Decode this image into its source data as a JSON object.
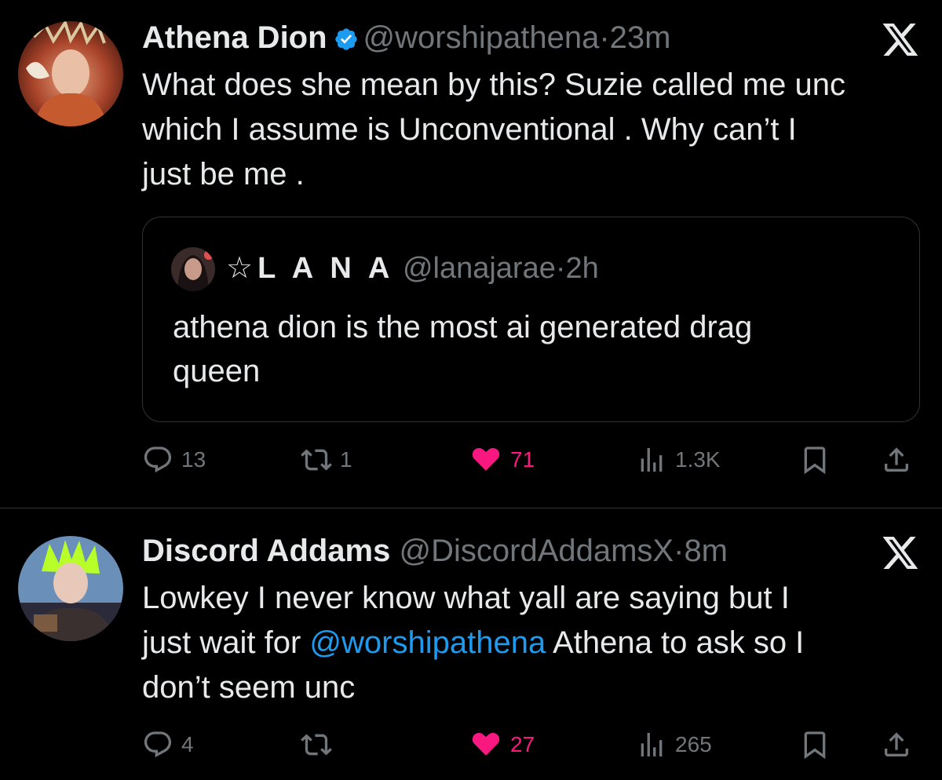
{
  "tweets": [
    {
      "name": "Athena Dion",
      "handle": "@worshipathena",
      "separator": "·",
      "time": "23m",
      "text": "What does she mean by this? Suzie called me unc\nwhich I assume is Unconventional . Why can’t I\njust be me .",
      "quote": {
        "name": "☆L A N A",
        "handle": "@lanajarae",
        "separator": "·",
        "time": "2h",
        "text": "athena dion is the most ai generated drag\nqueen"
      },
      "replies": "13",
      "reposts": "1",
      "likes": "71",
      "views": "1.3K"
    },
    {
      "name": "Discord Addams",
      "handle": "@DiscordAddamsX",
      "separator": "·",
      "time": "8m",
      "text_before": "Lowkey I never know what yall are saying but I\njust wait for ",
      "mention": "@worshipathena",
      "text_after": " Athena to ask so I\ndon’t seem unc",
      "replies": "4",
      "reposts": "",
      "likes": "27",
      "views": "265"
    }
  ],
  "colors": {
    "background": "#000000",
    "text": "#e7e9ea",
    "secondary": "#71767b",
    "mention": "#1d9bf0",
    "verified": "#1d9bf0",
    "like": "#f91880",
    "border": "#2f3336"
  },
  "icons": [
    "verified-badge-icon",
    "x-logo-icon",
    "reply-icon",
    "repost-icon",
    "heart-icon",
    "views-icon",
    "bookmark-icon",
    "share-icon"
  ]
}
